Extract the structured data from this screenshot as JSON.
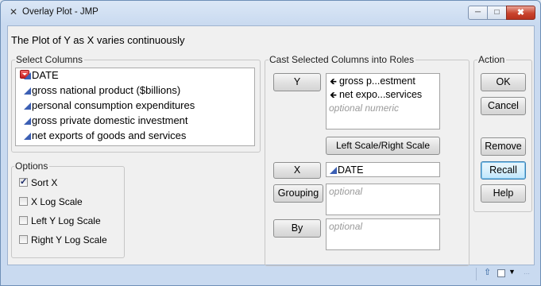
{
  "window": {
    "title": "Overlay Plot - JMP",
    "controls": {
      "minimize": "minimize",
      "maximize": "maximize",
      "close": "close"
    }
  },
  "heading": "The Plot of Y as X varies continuously",
  "select_columns": {
    "legend": "Select Columns",
    "columns": [
      "DATE",
      "gross national product ($billions)",
      "personal consumption expenditures",
      "gross private domestic investment",
      "net exports of goods and services"
    ]
  },
  "options": {
    "legend": "Options",
    "items": [
      {
        "label": "Sort X",
        "checked": true
      },
      {
        "label": "X Log Scale",
        "checked": false
      },
      {
        "label": "Left Y Log Scale",
        "checked": false
      },
      {
        "label": "Right Y Log Scale",
        "checked": false
      }
    ]
  },
  "roles": {
    "legend": "Cast Selected Columns into Roles",
    "y": {
      "button": "Y",
      "values": [
        "gross p...estment",
        "net expo...services"
      ],
      "placeholder": "optional numeric"
    },
    "scale_button": "Left Scale/Right Scale",
    "x": {
      "button": "X",
      "value": "DATE"
    },
    "grouping": {
      "button": "Grouping",
      "placeholder": "optional"
    },
    "by": {
      "button": "By",
      "placeholder": "optional"
    }
  },
  "action": {
    "legend": "Action",
    "ok": "OK",
    "cancel": "Cancel",
    "remove": "Remove",
    "recall": "Recall",
    "help": "Help"
  },
  "status_icons": {
    "up": "up-arrow-icon",
    "checkbox": "checkbox-icon",
    "dropdown": "dropdown-arrow-icon"
  }
}
